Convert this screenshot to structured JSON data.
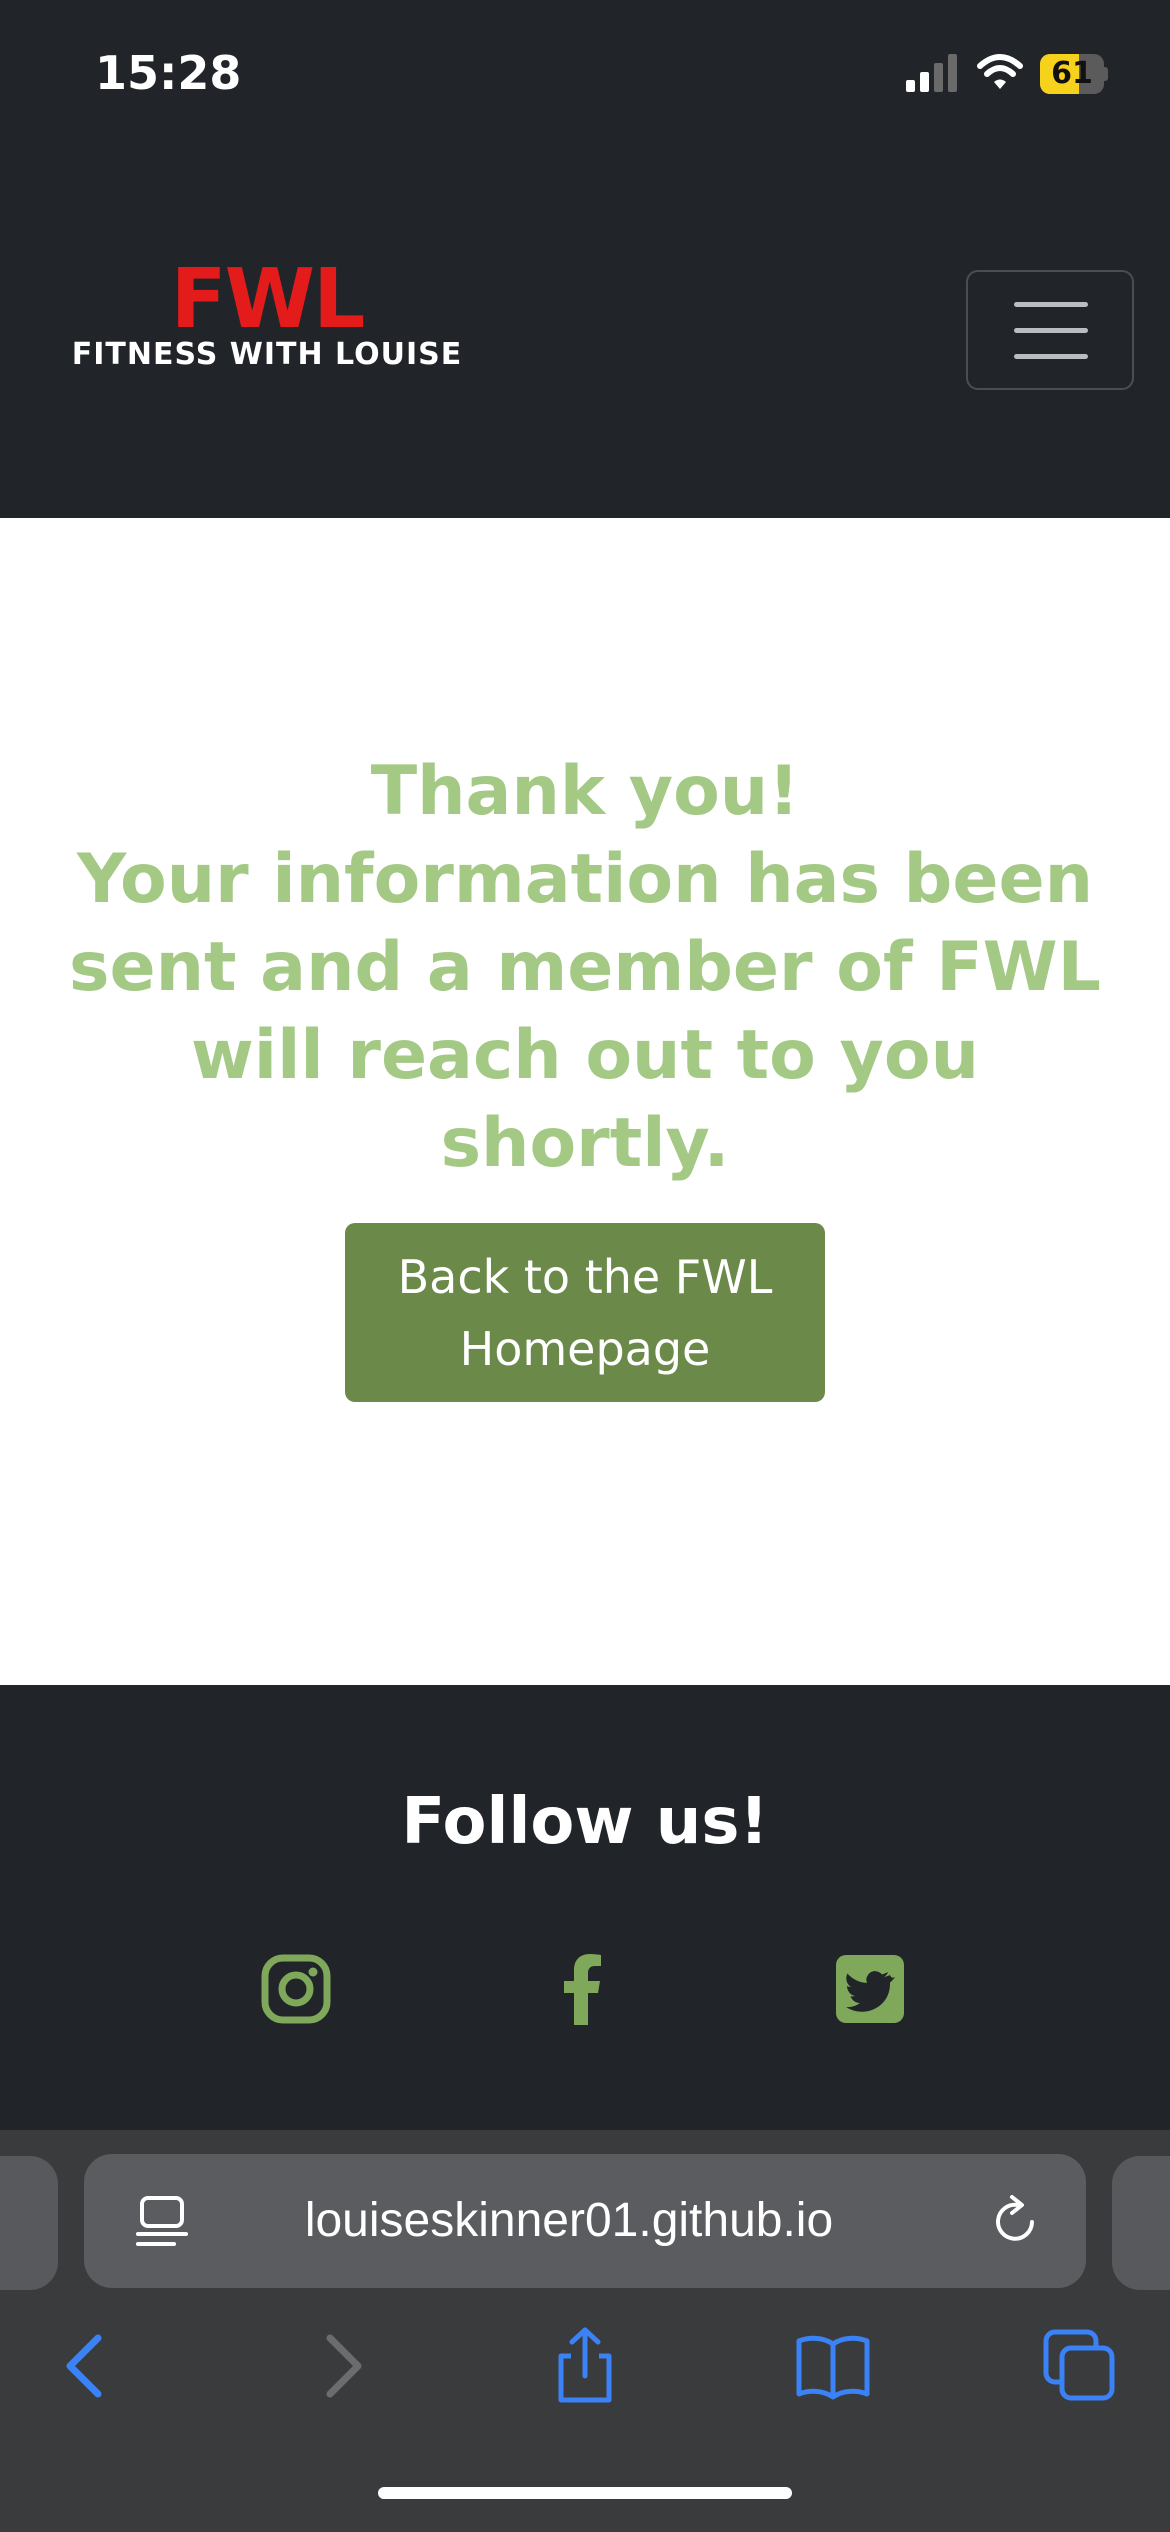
{
  "status_bar": {
    "time": "15:28",
    "battery_level": "61",
    "battery_fraction": 0.61,
    "icons": [
      "signal-icon",
      "wifi-icon",
      "battery-icon"
    ]
  },
  "navbar": {
    "logo_mark": "FWL",
    "logo_subtitle": "FITNESS WITH LOUISE",
    "toggler_icon": "hamburger-menu-icon"
  },
  "main": {
    "heading_line1": "Thank you!",
    "heading_line2": "Your information has been sent and a member of FWL will reach out to you shortly.",
    "back_button_label": "Back to the FWL Homepage"
  },
  "footer": {
    "heading": "Follow us!",
    "social_icons": [
      "instagram-icon",
      "facebook-icon",
      "twitter-icon"
    ]
  },
  "browser": {
    "url": "louiseskinner01.github.io",
    "toolbar_icons": [
      "back-icon",
      "forward-icon",
      "share-icon",
      "bookmarks-icon",
      "tabs-icon"
    ]
  },
  "colors": {
    "dark_bg": "#212529",
    "accent_green": "#a3c985",
    "button_green": "#6b8a4a",
    "logo_red": "#e31b1b",
    "ios_blue": "#3b82f6"
  }
}
